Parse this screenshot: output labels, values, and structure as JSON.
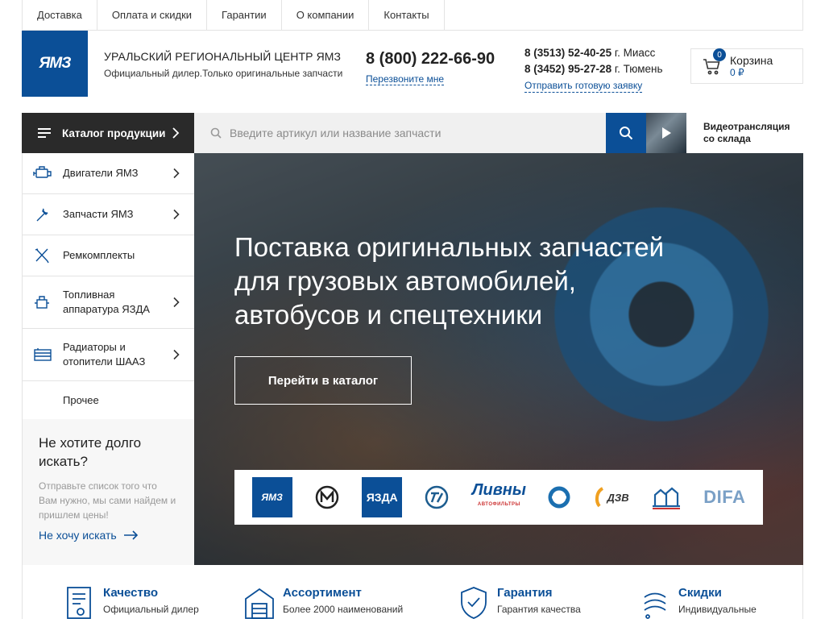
{
  "topnav": [
    "Доставка",
    "Оплата и скидки",
    "Гарантии",
    "О компании",
    "Контакты"
  ],
  "logo": {
    "text": "ЯМЗ"
  },
  "company": {
    "name": "Уральский региональный центр ЯМЗ",
    "subtitle": "Официальный дилер.Только оригинальные запчасти"
  },
  "phone": {
    "main": "8 (800) 222-66-90",
    "callback": "Перезвоните мне"
  },
  "phones": [
    {
      "number": "8 (3513) 52-40-25",
      "city": "г. Миасс"
    },
    {
      "number": "8 (3452) 95-27-28",
      "city": "г. Тюмень"
    }
  ],
  "request_link": "Отправить готовую заявку",
  "cart": {
    "count": "0",
    "label": "Корзина",
    "sum": "0 ₽"
  },
  "catalog_button": "Каталог продукции",
  "search": {
    "placeholder": "Введите артикул или название запчасти"
  },
  "video": {
    "line1": "Видеотрансляция",
    "line2": "со склада"
  },
  "sidebar": [
    {
      "line1": "Двигатели ЯМЗ",
      "line2": "",
      "icon": "engine-icon",
      "chevron": true
    },
    {
      "line1": "Запчасти ЯМЗ",
      "line2": "",
      "icon": "wrench-icon",
      "chevron": true
    },
    {
      "line1": "Ремкомплекты",
      "line2": "",
      "icon": "tools-icon",
      "chevron": false
    },
    {
      "line1": "Топливная",
      "line2": "аппаратура ЯЗДА",
      "icon": "fuel-pump-icon",
      "chevron": true
    },
    {
      "line1": "Радиаторы и",
      "line2": "отопители ШААЗ",
      "icon": "radiator-icon",
      "chevron": true
    },
    {
      "line1": "Прочее",
      "line2": "",
      "icon": "",
      "chevron": false
    }
  ],
  "promo": {
    "title_line1": "Не хотите долго",
    "title_line2": "искать?",
    "text_line1": "Отправьте список того что",
    "text_line2": "Вам нужно, мы сами найдем и",
    "text_line3": "пришлем цены!",
    "link": "Не хочу искать"
  },
  "hero": {
    "line1": "Поставка оригинальных запчастей",
    "line2": "для грузовых автомобилей,",
    "line3": "автобусов и спецтехники",
    "button": "Перейти в каталог"
  },
  "brands": {
    "yamz": "ЯМЗ",
    "yazda": "ЯЗДА",
    "livny": "Ливны",
    "livny_sub": "АВТОФИЛЬТРЫ",
    "dzv": "ДЗВ",
    "difa": "DIFA"
  },
  "features": [
    {
      "title": "Качество",
      "subtitle": "Официальный дилер",
      "icon": "certificate-icon"
    },
    {
      "title": "Ассортимент",
      "subtitle": "Более 2000 наименований",
      "icon": "warehouse-icon"
    },
    {
      "title": "Гарантия",
      "subtitle": "Гарантия качества",
      "icon": "shield-icon"
    },
    {
      "title": "Скидки",
      "subtitle": "Индивидуальные",
      "icon": "discount-icon"
    }
  ],
  "colors": {
    "brand_blue": "#0b4f97",
    "dark": "#2a2a2a"
  }
}
